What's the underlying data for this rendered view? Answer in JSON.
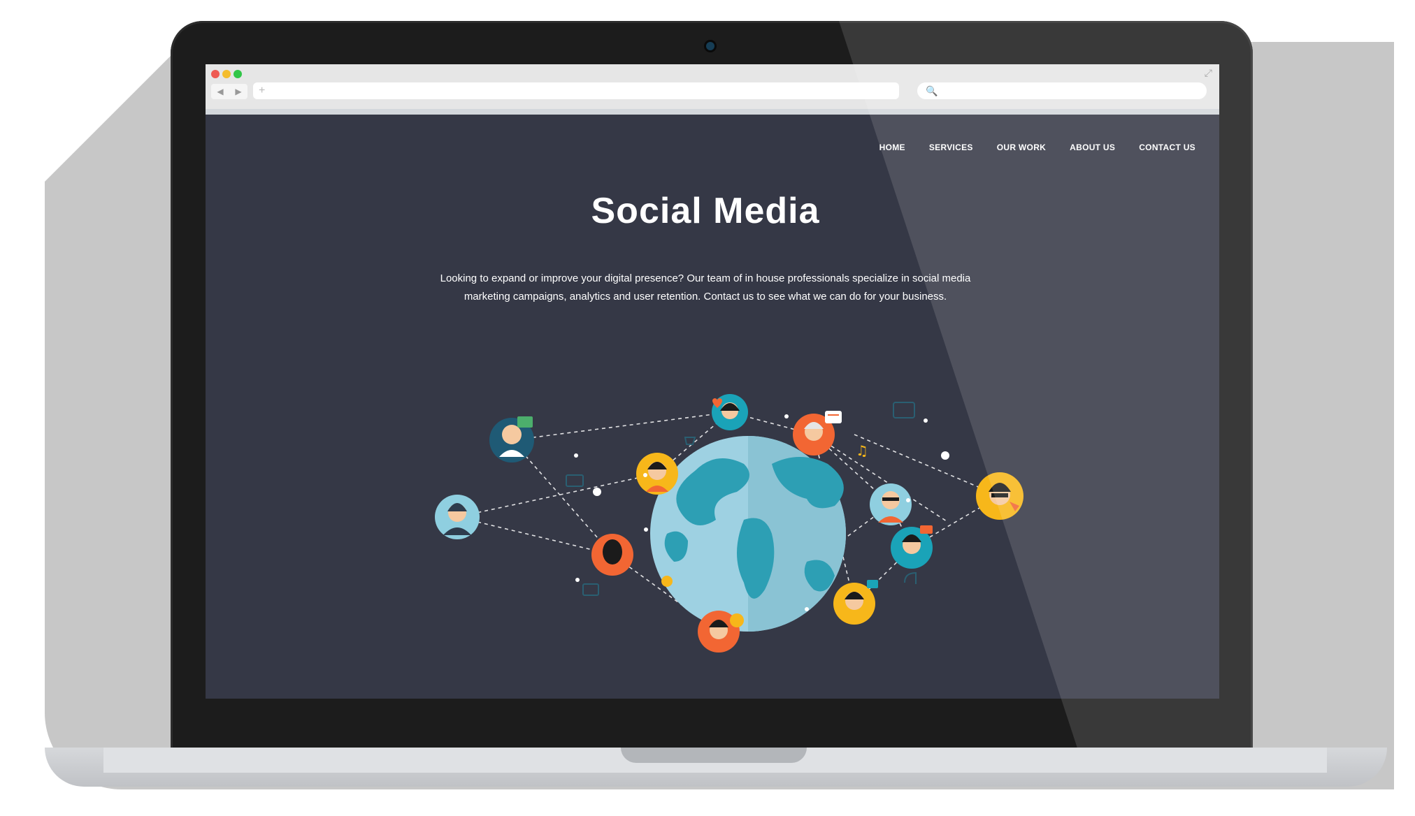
{
  "browser": {
    "address_placeholder": "+",
    "search_icon": "🔍",
    "back_icon": "◀",
    "forward_icon": "▶",
    "expand_icon": "⤢"
  },
  "nav": {
    "items": [
      "HOME",
      "SERVICES",
      "OUR WORK",
      "ABOUT US",
      "CONTACT US"
    ]
  },
  "hero": {
    "title": "Social Media",
    "line1": "Looking to expand or improve your digital presence? Our team of in house professionals specialize in social media",
    "line2": "marketing campaigns, analytics and user retention. Contact us to see what we can do for your business."
  },
  "colors": {
    "page_bg": "#353846",
    "globe_ocean": "#9ed1e2",
    "globe_land": "#2d9fb4",
    "orange": "#f26633",
    "yellow": "#f7b71a",
    "teal": "#1aa3b8",
    "light_blue": "#8fcfe0"
  }
}
